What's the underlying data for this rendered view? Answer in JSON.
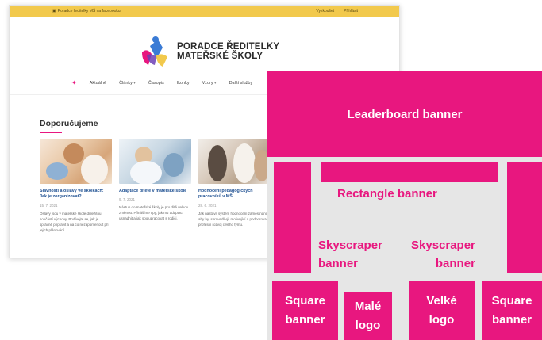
{
  "site": {
    "topbar": {
      "left_text": "Poradce ředitelky MŠ na facebooku",
      "links": [
        "Vyzkoušet",
        "Přihlásit"
      ]
    },
    "brand": {
      "line1": "PORADCE ŘEDITELKY",
      "line2": "MATEŘSKÉ ŠKOLY"
    },
    "nav": {
      "items": [
        "Aktuálně",
        "Články",
        "Časopis",
        "Ikonky",
        "Vzory",
        "Další služby"
      ]
    },
    "section_title": "Doporučujeme",
    "cards": [
      {
        "title": "Slavnosti a oslavy ve školkách: Jak je zorganizovat?",
        "date": "15. 7. 2021",
        "excerpt": "Oslavy jsou v mateřské škole důležitou součástí výchovy. Podívejte se, jak je správně připravit a na co nezapomenout při jejich plánování."
      },
      {
        "title": "Adaptace dítěte v mateřské škole",
        "date": "9. 7. 2021",
        "excerpt": "Nástup do mateřské školy je pro dítě velkou změnou. Přinášíme tipy, jak mu adaptaci usnadnit a jak spolupracovat s rodiči."
      },
      {
        "title": "Hodnocení pedagogických pracovníků v MŠ",
        "date": "28. 6. 2021",
        "excerpt": "Jak nastavit systém hodnocení zaměstnanců, aby byl spravedlivý, motivující a podporoval profesní rozvoj celého týmu."
      }
    ]
  },
  "banners": {
    "leaderboard": "Leaderboard banner",
    "rectangle": "Rectangle banner",
    "skyscraper_left": [
      "Skyscraper",
      "banner"
    ],
    "skyscraper_right": [
      "Skyscraper",
      "banner"
    ],
    "square_left": [
      "Square",
      "banner"
    ],
    "small_logo": [
      "Malé",
      "logo"
    ],
    "large_logo": [
      "Velké",
      "logo"
    ],
    "square_right": [
      "Square",
      "banner"
    ]
  },
  "colors": {
    "accent": "#e8177f",
    "topbar": "#f2c94c",
    "diagram_bg": "#e6e6e6"
  }
}
